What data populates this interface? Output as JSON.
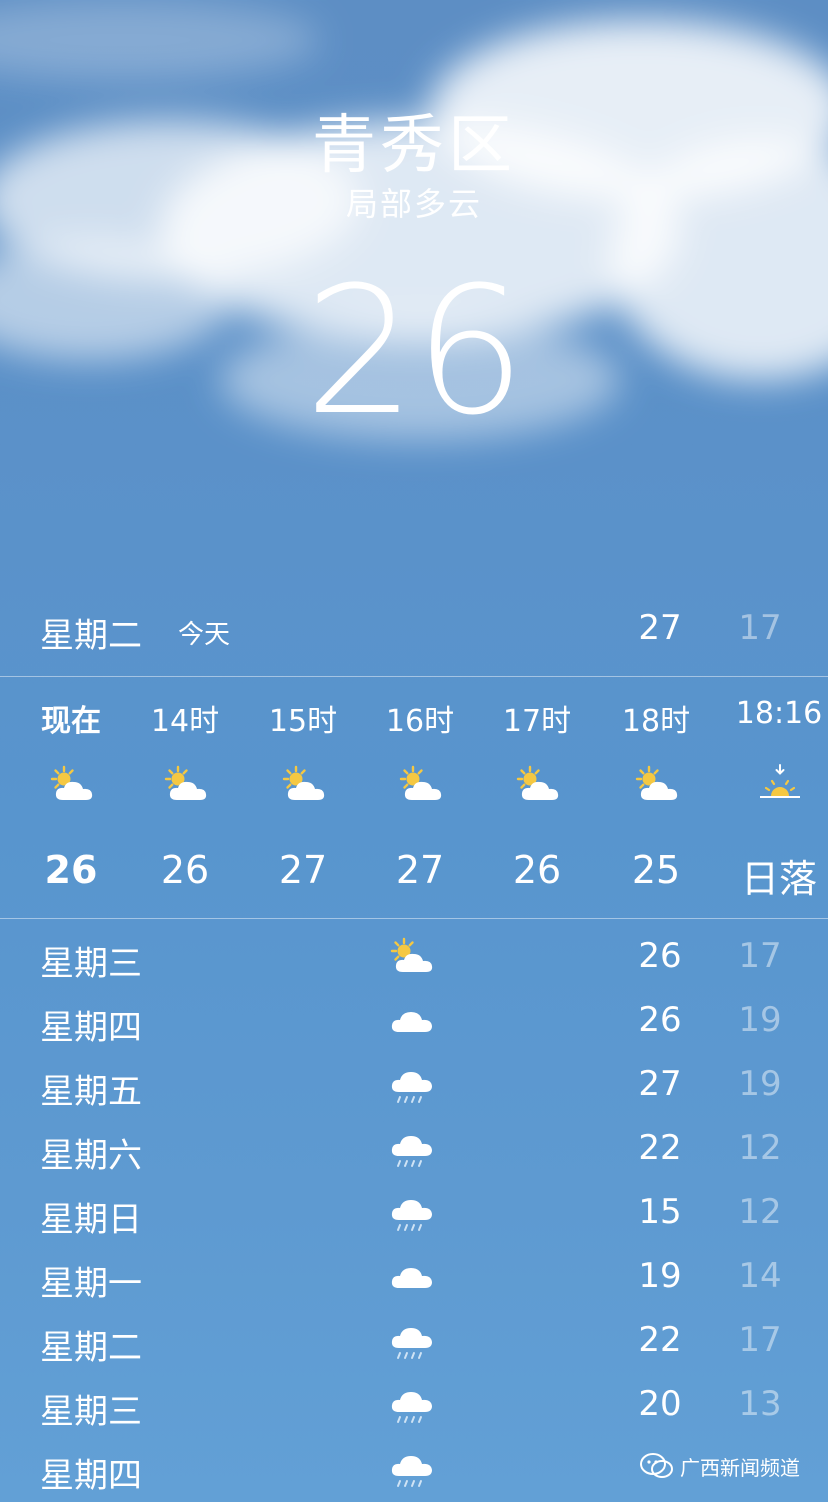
{
  "location": {
    "city": "青秀区",
    "condition": "局部多云",
    "temperature": "26"
  },
  "today": {
    "day": "星期二",
    "tag": "今天",
    "high": "27",
    "low": "17"
  },
  "hourly": [
    {
      "time": "现在",
      "icon": "partly-cloudy-icon",
      "temp": "26",
      "now": true
    },
    {
      "time": "14时",
      "icon": "partly-cloudy-icon",
      "temp": "26"
    },
    {
      "time": "15时",
      "icon": "partly-cloudy-icon",
      "temp": "27"
    },
    {
      "time": "16时",
      "icon": "partly-cloudy-icon",
      "temp": "27"
    },
    {
      "time": "17时",
      "icon": "partly-cloudy-icon",
      "temp": "26"
    },
    {
      "time": "18时",
      "icon": "partly-cloudy-icon",
      "temp": "25"
    },
    {
      "time": "18:16",
      "icon": "sunset-icon",
      "temp": "日落"
    }
  ],
  "daily": [
    {
      "day": "星期三",
      "icon": "partly-cloudy-icon",
      "high": "26",
      "low": "17"
    },
    {
      "day": "星期四",
      "icon": "cloud-icon",
      "high": "26",
      "low": "19"
    },
    {
      "day": "星期五",
      "icon": "rain-icon",
      "high": "27",
      "low": "19"
    },
    {
      "day": "星期六",
      "icon": "rain-icon",
      "high": "22",
      "low": "12"
    },
    {
      "day": "星期日",
      "icon": "rain-icon",
      "high": "15",
      "low": "12"
    },
    {
      "day": "星期一",
      "icon": "cloud-icon",
      "high": "19",
      "low": "14"
    },
    {
      "day": "星期二",
      "icon": "rain-icon",
      "high": "22",
      "low": "17"
    },
    {
      "day": "星期三",
      "icon": "rain-icon",
      "high": "20",
      "low": "13"
    },
    {
      "day": "星期四",
      "icon": "rain-icon",
      "high": "",
      "low": ""
    }
  ],
  "watermark": {
    "text": "广西新闻频道",
    "icon": "wechat-icon"
  },
  "colors": {
    "sky_top": "#5d8ec4",
    "sky_bottom": "#62a0d6",
    "sun": "#f5c842",
    "low_temp": "rgba(255,255,255,0.45)"
  }
}
